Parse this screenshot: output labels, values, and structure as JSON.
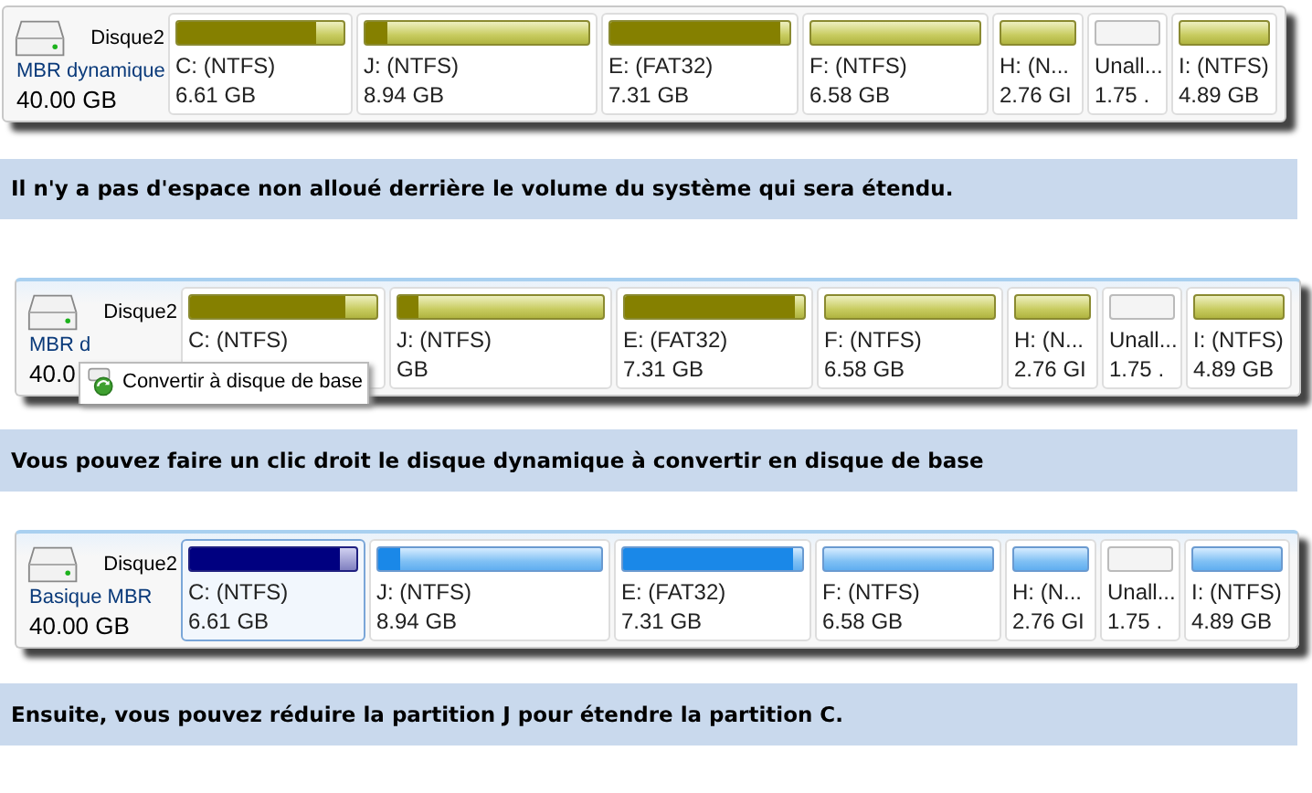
{
  "sections": [
    {
      "disk": {
        "name": "Disque2",
        "type": "MBR dynamique",
        "size": "40.00 GB",
        "kind": "dynamic"
      },
      "partitions": [
        {
          "kind": "partition",
          "label": "C: (NTFS)",
          "size": "6.61 GB",
          "level": 0.83,
          "selected": false
        },
        {
          "kind": "partition",
          "label": "J: (NTFS)",
          "size": "8.94 GB",
          "level": 0.1,
          "selected": false
        },
        {
          "kind": "partition",
          "label": "E: (FAT32)",
          "size": "7.31 GB",
          "level": 0.95,
          "selected": false
        },
        {
          "kind": "partition",
          "label": "F: (NTFS)",
          "size": "6.58 GB",
          "level": 0,
          "selected": false
        },
        {
          "kind": "partition",
          "label": "H: (N...",
          "size": "2.76 GI",
          "level": 0,
          "selected": false
        },
        {
          "kind": "unallocated",
          "label": "Unall...",
          "size": "1.75 ."
        },
        {
          "kind": "partition",
          "label": "I: (NTFS)",
          "size": "4.89 GB",
          "level": 0,
          "selected": false
        }
      ],
      "caption": "Il n'y a pas d'espace non alloué derrière le volume du système qui sera étendu."
    },
    {
      "disk": {
        "name": "Disque2",
        "type": "MBR d",
        "size": "40.0",
        "kind": "dynamic"
      },
      "partitions": [
        {
          "kind": "partition",
          "label": "C: (NTFS)",
          "level": 0.83,
          "selected": false
        },
        {
          "kind": "partition",
          "label": "J: (NTFS)",
          "size": "GB",
          "level": 0.1,
          "selected": false
        },
        {
          "kind": "partition",
          "label": "E: (FAT32)",
          "size": "7.31 GB",
          "level": 0.95,
          "selected": false
        },
        {
          "kind": "partition",
          "label": "F: (NTFS)",
          "size": "6.58 GB",
          "level": 0,
          "selected": false
        },
        {
          "kind": "partition",
          "label": "H: (N...",
          "size": "2.76 GI",
          "level": 0,
          "selected": false
        },
        {
          "kind": "unallocated",
          "label": "Unall...",
          "size": "1.75 ."
        },
        {
          "kind": "partition",
          "label": "I: (NTFS)",
          "size": "4.89 GB",
          "level": 0,
          "selected": false
        }
      ],
      "menu": {
        "items": [
          {
            "label": "Convertir à disque de base"
          }
        ]
      },
      "caption": "Vous pouvez faire un clic droit le disque dynamique à convertir en disque de base"
    },
    {
      "disk": {
        "name": "Disque2",
        "type": "Basique MBR",
        "size": "40.00 GB",
        "kind": "basic"
      },
      "partitions": [
        {
          "kind": "partition",
          "label": "C: (NTFS)",
          "size": "6.61 GB",
          "level": 0.9,
          "selected": true
        },
        {
          "kind": "partition",
          "label": "J: (NTFS)",
          "size": "8.94 GB",
          "level": 0.1,
          "selected": false
        },
        {
          "kind": "partition",
          "label": "E: (FAT32)",
          "size": "7.31 GB",
          "level": 0.95,
          "selected": false
        },
        {
          "kind": "partition",
          "label": "F: (NTFS)",
          "size": "6.58 GB",
          "level": 0,
          "selected": false
        },
        {
          "kind": "partition",
          "label": "H: (N...",
          "size": "2.76 GI",
          "level": 0,
          "selected": false
        },
        {
          "kind": "unallocated",
          "label": "Unall...",
          "size": "1.75 ."
        },
        {
          "kind": "partition",
          "label": "I: (NTFS)",
          "size": "4.89 GB",
          "level": 0,
          "selected": false
        }
      ],
      "caption": "Ensuite, vous pouvez réduire la partition J pour étendre la partition C."
    }
  ]
}
